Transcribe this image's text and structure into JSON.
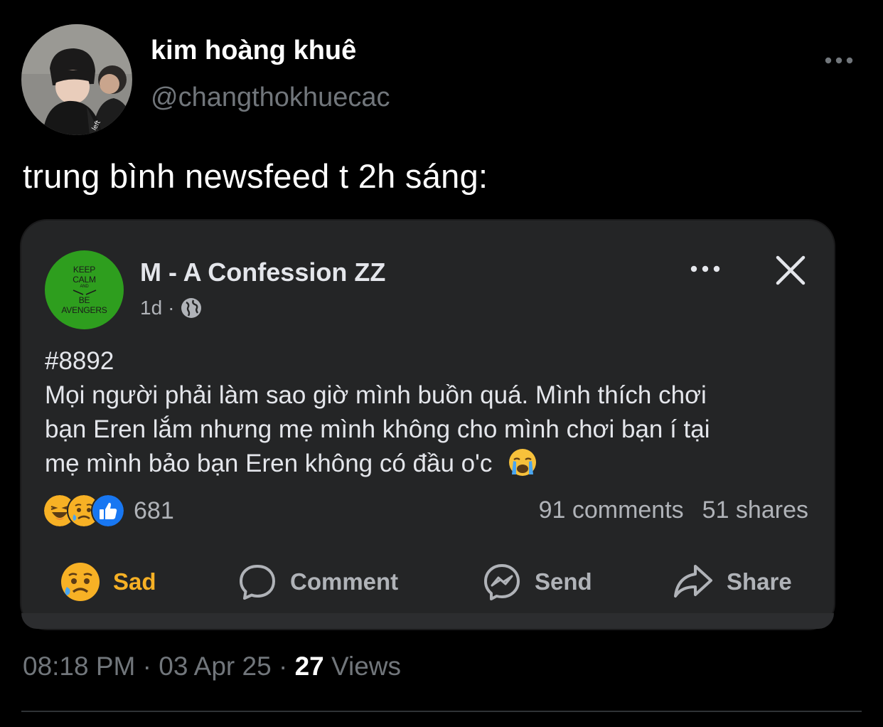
{
  "tweet": {
    "display_name": "kim hoàng khuê",
    "handle": "@changthokhuecac",
    "text": "trung bình newsfeed t 2h sáng:",
    "time": "08:18 PM",
    "date": "03 Apr 25",
    "views_count": "27",
    "views_label": "Views",
    "separator": "·"
  },
  "fb_post": {
    "page_name": "M - A Confession ZZ",
    "page_avatar_text": [
      "KEEP",
      "CALM",
      "AND",
      "BE",
      "AVENGERS"
    ],
    "age": "1d",
    "meta_separator": "·",
    "body_lines": [
      "#8892",
      "Mọi người phải làm sao giờ mình buồn quá. Mình thích chơi",
      "bạn Eren lắm nhưng mẹ mình không cho mình chơi bạn í tại",
      "mẹ mình bảo bạn Eren không có đầu o'c"
    ],
    "reaction_count": "681",
    "comments": "91 comments",
    "shares": "51 shares",
    "actions": {
      "sad": "Sad",
      "comment": "Comment",
      "send": "Send",
      "share": "Share"
    }
  },
  "colors": {
    "background": "#000000",
    "card": "#242526",
    "sad_accent": "#f7b125",
    "like_blue": "#1877f2",
    "muted": "#71767b"
  },
  "icons": [
    "avatar",
    "more-icon",
    "globe-icon",
    "close-icon",
    "crying-emoji",
    "haha-reaction-icon",
    "sad-reaction-icon",
    "like-reaction-icon",
    "sad-face-icon",
    "comment-bubble-icon",
    "messenger-icon",
    "share-arrow-icon"
  ]
}
